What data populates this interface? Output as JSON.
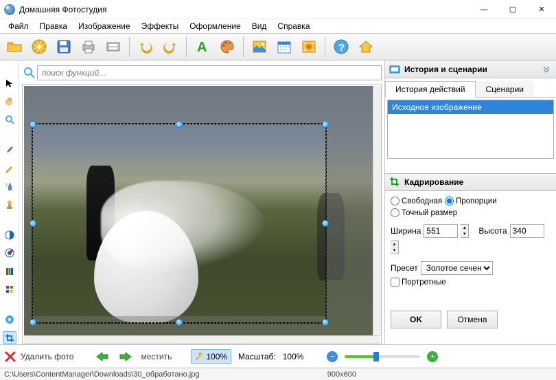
{
  "title": "Домашняя Фотостудия",
  "menu": {
    "file": "Файл",
    "edit": "Правка",
    "image": "Изображение",
    "effects": "Эффекты",
    "decorate": "Оформление",
    "view": "Вид",
    "help": "Справка"
  },
  "search": {
    "placeholder": "поиск функций..."
  },
  "right": {
    "history_title": "История и сценарии",
    "tab_history": "История действий",
    "tab_scenarios": "Сценарии",
    "hist_item_0": "Исходное изображение",
    "crop_title": "Кадрирование",
    "opt_free": "Свободная",
    "opt_prop": "Пропорции",
    "opt_exact": "Точный размер",
    "width_label": "Ширина",
    "width_value": "551",
    "height_label": "Высота",
    "height_value": "340",
    "preset_label": "Пресет",
    "preset_value": "Золотое сечение",
    "portrait_label": "Портретные",
    "ok": "OK",
    "cancel": "Отмена"
  },
  "bottom": {
    "delete": "Удалить фото",
    "fit_word": "местить",
    "zoom_actual": "100%",
    "zoom_label": "Масштаб:",
    "zoom_value": "100%"
  },
  "status": {
    "path": "C:\\Users\\ContentManager\\Downloads\\30_обработано.jpg",
    "dim": "900x600"
  }
}
